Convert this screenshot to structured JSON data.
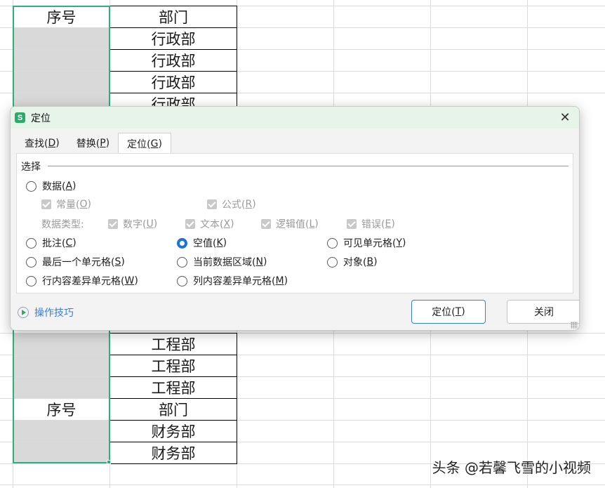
{
  "sheet": {
    "top_rows": [
      {
        "seq": "序号",
        "dept": "部门"
      },
      {
        "seq": "",
        "dept": "行政部"
      },
      {
        "seq": "",
        "dept": "行政部"
      },
      {
        "seq": "",
        "dept": "行政部"
      },
      {
        "seq": "",
        "dept": "行政部"
      }
    ],
    "bottom_rows": [
      {
        "seq": "",
        "dept": "工程部"
      },
      {
        "seq": "",
        "dept": "工程部"
      },
      {
        "seq": "",
        "dept": "工程部"
      },
      {
        "seq": "序号",
        "dept": "部门"
      },
      {
        "seq": "",
        "dept": "财务部"
      },
      {
        "seq": "",
        "dept": "财务部"
      }
    ],
    "selection_color": "#2bb17b",
    "selected_fill": "#d9d9d9"
  },
  "watermark": "头条 @若馨飞雪的小视频",
  "dialog": {
    "app_icon": "S",
    "title": "定位",
    "close_icon": "close-icon",
    "tabs": [
      {
        "label": "查找(",
        "key": "D",
        "end": ")"
      },
      {
        "label": "替换(",
        "key": "P",
        "end": ")"
      },
      {
        "label": "定位(",
        "key": "G",
        "end": ")",
        "active": true
      }
    ],
    "group_label": "选择",
    "options": {
      "data": {
        "label": "数据(",
        "key": "A",
        "end": ")"
      },
      "constants": {
        "label": "常量(",
        "key": "O",
        "end": ")"
      },
      "formulas": {
        "label": "公式(",
        "key": "R",
        "end": ")"
      },
      "data_type_label": "数据类型:",
      "numbers": {
        "label": "数字(",
        "key": "U",
        "end": ")"
      },
      "text": {
        "label": "文本(",
        "key": "X",
        "end": ")"
      },
      "logical": {
        "label": "逻辑值(",
        "key": "L",
        "end": ")"
      },
      "errors": {
        "label": "错误(",
        "key": "E",
        "end": ")"
      },
      "comments": {
        "label": "批注(",
        "key": "C",
        "end": ")"
      },
      "blanks": {
        "label": "空值(",
        "key": "K",
        "end": ")",
        "checked": true
      },
      "visible": {
        "label": "可见单元格(",
        "key": "Y",
        "end": ")"
      },
      "last_cell": {
        "label": "最后一个单元格(",
        "key": "S",
        "end": ")"
      },
      "current_region": {
        "label": "当前数据区域(",
        "key": "N",
        "end": ")"
      },
      "objects": {
        "label": "对象(",
        "key": "B",
        "end": ")"
      },
      "row_diff": {
        "label": "行内容差异单元格(",
        "key": "W",
        "end": ")"
      },
      "col_diff": {
        "label": "列内容差异单元格(",
        "key": "M",
        "end": ")"
      }
    },
    "tips_label": "操作技巧",
    "locate_button": {
      "label": "定位(",
      "key": "T",
      "end": ")"
    },
    "close_button": "关闭",
    "accent_color": "#1d74d6",
    "titlebar_color": "#e6f4e9"
  }
}
